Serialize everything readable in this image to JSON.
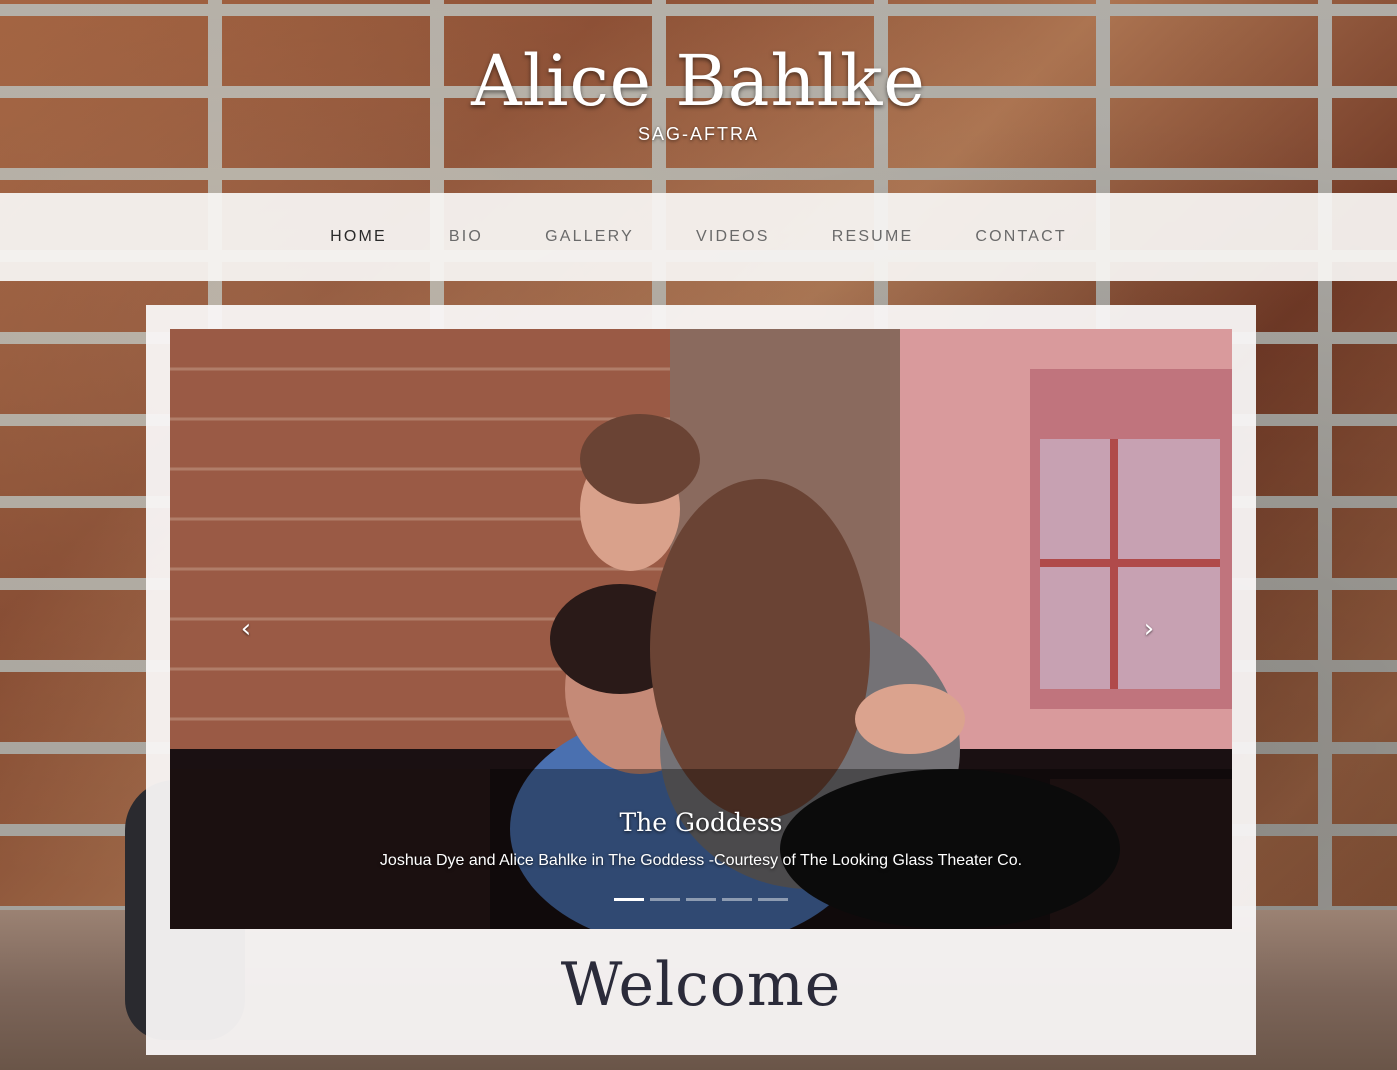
{
  "header": {
    "title": "Alice Bahlke",
    "subtitle": "SAG-AFTRA"
  },
  "nav": {
    "items": [
      {
        "label": "HOME",
        "active": true
      },
      {
        "label": "BIO",
        "active": false
      },
      {
        "label": "GALLERY",
        "active": false
      },
      {
        "label": "VIDEOS",
        "active": false
      },
      {
        "label": "RESUME",
        "active": false
      },
      {
        "label": "CONTACT",
        "active": false
      }
    ]
  },
  "carousel": {
    "prev_icon": "chevron-left-icon",
    "next_icon": "chevron-right-icon",
    "prev_glyph": "‹",
    "next_glyph": "›",
    "slide_count": 5,
    "active_index": 0,
    "caption_title": "The Goddess",
    "caption_text": "Joshua Dye and Alice Bahlke in The Goddess -Courtesy of The Looking Glass Theater Co."
  },
  "main": {
    "welcome": "Welcome"
  },
  "colors": {
    "nav_background": "#f6f4f2",
    "nav_text": "#6a6a6a",
    "nav_active_text": "#2a2a2a",
    "card_background": "#f8f6f5",
    "welcome_text": "#2b2b3a"
  }
}
